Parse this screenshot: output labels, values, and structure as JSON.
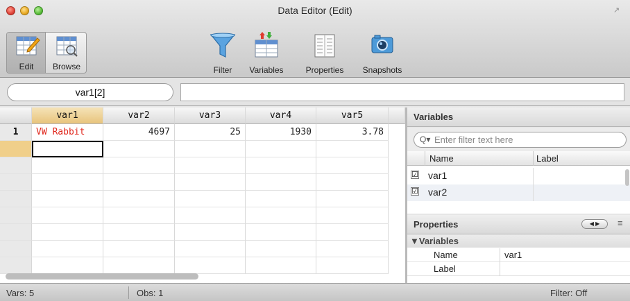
{
  "window": {
    "title": "Data Editor (Edit)"
  },
  "toolbar": {
    "edit_label": "Edit",
    "browse_label": "Browse",
    "filter_label": "Filter",
    "variables_label": "Variables",
    "properties_label": "Properties",
    "snapshots_label": "Snapshots"
  },
  "varname_field": {
    "value": "var1[2]"
  },
  "grid": {
    "columns": [
      "var1",
      "var2",
      "var3",
      "var4",
      "var5"
    ],
    "rows": [
      {
        "num": "1",
        "cells": [
          "VW Rabbit",
          "4697",
          "25",
          "1930",
          "3.78"
        ]
      }
    ],
    "string_color": "#e0261b",
    "selected_header_color": "#e8c47c"
  },
  "variables_panel": {
    "title": "Variables",
    "filter_placeholder": "Enter filter text here",
    "col_name": "Name",
    "col_label": "Label",
    "items": [
      {
        "name": "var1",
        "label": "",
        "checked": "☑"
      },
      {
        "name": "var2",
        "label": "",
        "checked": "☑"
      }
    ]
  },
  "properties_panel": {
    "title": "Properties",
    "section": "▼Variables",
    "rows": [
      {
        "key": "Name",
        "value": "var1"
      },
      {
        "key": "Label",
        "value": ""
      }
    ]
  },
  "status": {
    "vars": "Vars: 5",
    "obs": "Obs: 1",
    "filter": "Filter: Off"
  }
}
